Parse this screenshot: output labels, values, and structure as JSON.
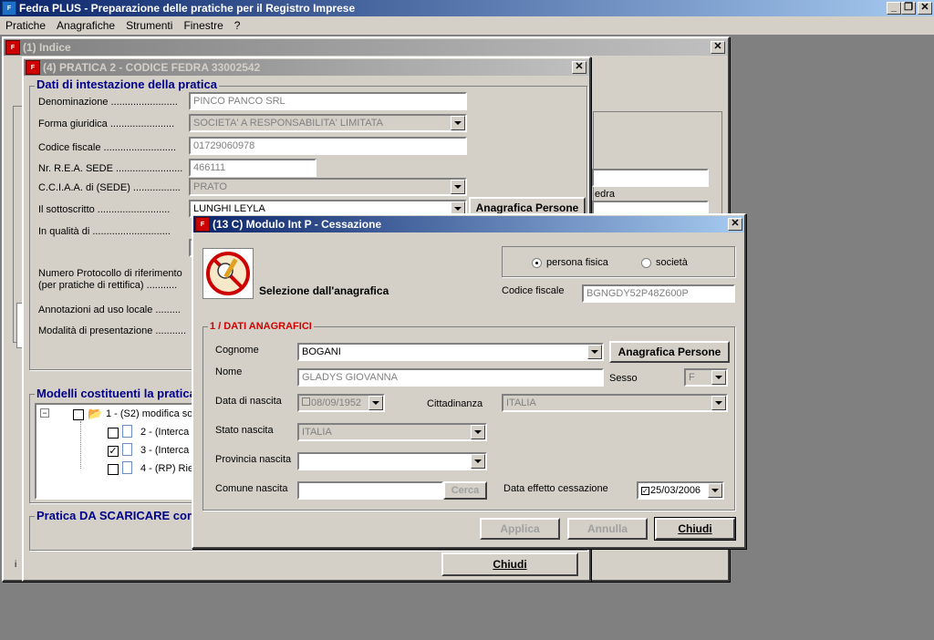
{
  "app": {
    "title": "Fedra PLUS  - Preparazione delle pratiche per il Registro Imprese",
    "menu": [
      "Pratiche",
      "Anagrafiche",
      "Strumenti",
      "Finestre",
      "?"
    ]
  },
  "win1": {
    "title": "(1) Indice"
  },
  "win4": {
    "title": "(4) PRATICA 2 - CODICE FEDRA 33002542",
    "section_title": "Dati di intestazione della pratica",
    "labels": {
      "denominazione": "Denominazione ........................",
      "forma": "Forma giuridica .......................",
      "cf": "Codice fiscale ..........................",
      "rea": "Nr. R.E.A. SEDE ........................",
      "cciaa": "C.C.I.A.A. di (SEDE) .................",
      "sottoscritto": "Il sottoscritto ..........................",
      "qualita": "In qualità di ............................",
      "protocollo1": "Numero Protocollo di riferimento",
      "protocollo2": "(per pratiche di rettifica) ...........",
      "annotazioni": "Annotazioni ad  uso locale .........",
      "modalita": "Modalità di presentazione ..........."
    },
    "values": {
      "denominazione": "PINCO PANCO SRL",
      "forma": "SOCIETA' A RESPONSABILITA' LIMITATA",
      "cf": "01729060978",
      "rea": "466111",
      "cciaa": "PRATO",
      "sottoscritto": "LUNGHI LEYLA"
    },
    "anagrafica_btn": "Anagrafica Persone",
    "modelli_title": "Modelli costituenti la pratica",
    "tree": [
      "1 - (S2) modifica so",
      "2 - (Interca",
      "3 - (Interca",
      "4 - (RP) Rie"
    ],
    "tree_checked": [
      false,
      false,
      true,
      false
    ],
    "scaricare_title": "Pratica DA SCARICARE cor",
    "chiudi": "Chiudi",
    "side_text": "edra"
  },
  "dlg": {
    "title": "(13 C) Modulo Int P - Cessazione",
    "radio_fisica": "persona fisica",
    "radio_societa": "società",
    "selezione": "Selezione dall'anagrafica",
    "cf_label": "Codice fiscale",
    "cf_value": "BGNGDY52P48Z600P",
    "group_title": "1 / DATI ANAGRAFICI",
    "cognome_label": "Cognome",
    "cognome": "BOGANI",
    "anagrafica_btn": "Anagrafica Persone",
    "nome_label": "Nome",
    "nome": "GLADYS GIOVANNA",
    "sesso_label": "Sesso",
    "sesso": "F",
    "nascita_label": "Data di nascita",
    "nascita": "08/09/1952",
    "cittadinanza_label": "Cittadinanza",
    "cittadinanza": "ITALIA",
    "stato_label": "Stato nascita",
    "stato": "ITALIA",
    "provincia_label": "Provincia nascita",
    "provincia": "",
    "comune_label": "Comune nascita",
    "comune": "",
    "cerca": "Cerca",
    "effetto_label": "Data effetto cessazione",
    "effetto": "25/03/2006",
    "applica": "Applica",
    "annulla": "Annulla",
    "chiudi": "Chiudi"
  }
}
